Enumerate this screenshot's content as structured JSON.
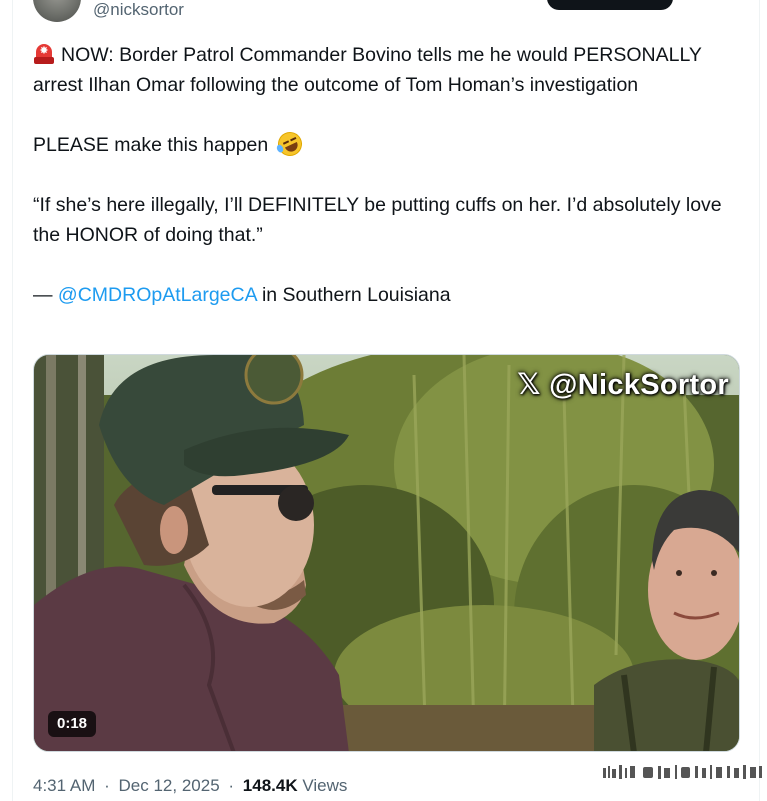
{
  "author": {
    "handle": "@nicksortor"
  },
  "tweet": {
    "line1_text": "NOW: Border Patrol Commander Bovino tells me he would PERSONALLY arrest Ilhan Omar following the outcome of Tom Homan’s investigation",
    "line2_text": "PLEASE make this happen",
    "quote": "“If she’s here illegally, I’ll DEFINITELY be putting cuffs on her. I’d absolutely love the HONOR of doing that.”",
    "attribution_prefix": "— ",
    "attribution_mention": "@CMDROpAtLargeCA",
    "attribution_suffix": " in Southern Louisiana",
    "icons": [
      "rotating-light-icon",
      "rolling-on-floor-laughing-icon"
    ]
  },
  "media": {
    "watermark": "𝕏 @NickSortor",
    "duration": "0:18"
  },
  "footer": {
    "time": "4:31 AM",
    "separator": "·",
    "date": "Dec 12, 2025",
    "views_count": "148.4K",
    "views_label": "Views"
  },
  "colors": {
    "text": "#0f1419",
    "secondary": "#536471",
    "link": "#1d9bf0"
  }
}
